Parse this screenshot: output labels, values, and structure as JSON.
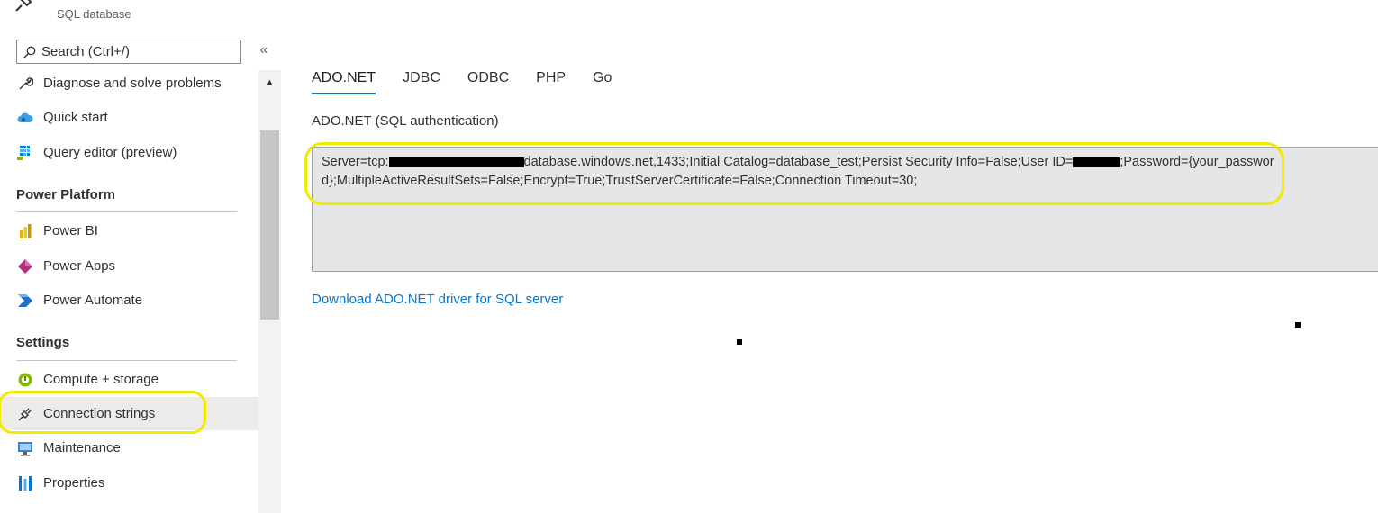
{
  "header": {
    "subtitle": "SQL database"
  },
  "sidebar": {
    "search_placeholder": "Search (Ctrl+/)",
    "collapse": "«",
    "scroll_up": "▲",
    "items": [
      {
        "label": "Diagnose and solve problems",
        "icon": "wrench-icon"
      },
      {
        "label": "Quick start",
        "icon": "cloud-icon"
      },
      {
        "label": "Query editor (preview)",
        "icon": "grid-icon"
      }
    ],
    "sections": [
      {
        "title": "Power Platform",
        "items": [
          {
            "label": "Power BI",
            "icon": "power-bi-icon"
          },
          {
            "label": "Power Apps",
            "icon": "power-apps-icon"
          },
          {
            "label": "Power Automate",
            "icon": "power-automate-icon"
          }
        ]
      },
      {
        "title": "Settings",
        "items": [
          {
            "label": "Compute + storage",
            "icon": "compute-storage-icon"
          },
          {
            "label": "Connection strings",
            "icon": "plug-icon",
            "selected": true
          },
          {
            "label": "Maintenance",
            "icon": "maintenance-icon"
          },
          {
            "label": "Properties",
            "icon": "properties-icon"
          }
        ]
      }
    ]
  },
  "main": {
    "tabs": [
      {
        "label": "ADO.NET",
        "active": true
      },
      {
        "label": "JDBC"
      },
      {
        "label": "ODBC"
      },
      {
        "label": "PHP"
      },
      {
        "label": "Go"
      }
    ],
    "auth_label": "ADO.NET (SQL authentication)",
    "connection_string": {
      "part1": "Server=tcp:",
      "part2": "database.windows.net,1433;Initial Catalog=database_test;Persist Security Info=False;User ID=",
      "part3": ";Password={your_password};MultipleActiveResultSets=False;Encrypt=True;TrustServerCertificate=False;Connection Timeout=30;"
    },
    "download_link": "Download ADO.NET driver for SQL server"
  },
  "colors": {
    "accent": "#0078d4",
    "highlight": "#f2ea00",
    "selected_bg": "#edebe9",
    "conn_box_bg": "#e6e6e6"
  }
}
